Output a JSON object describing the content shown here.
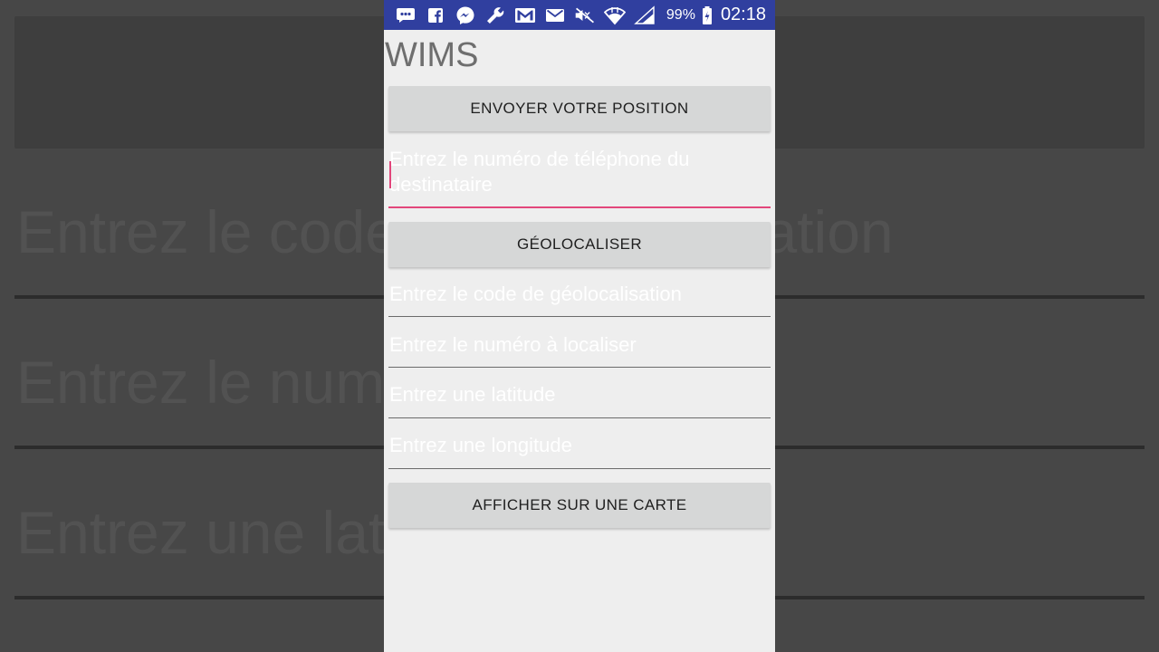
{
  "status_bar": {
    "battery": "99%",
    "time": "02:18",
    "icons": [
      "chat-icon",
      "facebook-icon",
      "messenger-icon",
      "wrench-icon",
      "gmail-icon",
      "mail-icon",
      "mute-icon",
      "wifi-icon",
      "signal-icon",
      "battery-charging-icon"
    ]
  },
  "app": {
    "title": "WIMS",
    "send_position_button": "ENVOYER VOTRE POSITION",
    "phone_placeholder": "Entrez le numéro de téléphone du destinataire",
    "geolocate_button": "GÉOLOCALISER",
    "code_placeholder": "Entrez le code de géolocalisation",
    "number_placeholder": "Entrez le numéro à localiser",
    "latitude_placeholder": "Entrez une latitude",
    "longitude_placeholder": "Entrez une longitude",
    "map_button": "AFFICHER SUR UNE CARTE"
  },
  "background": {
    "line1": "Entrez le code de géolocalisation",
    "line2": "Entrez le numéro à localiser",
    "line3": "Entrez une latitude"
  },
  "colors": {
    "status_bar": "#303f9f",
    "accent": "#e2467b",
    "button": "#d6d7d7",
    "screen_bg": "#eeeeee"
  }
}
